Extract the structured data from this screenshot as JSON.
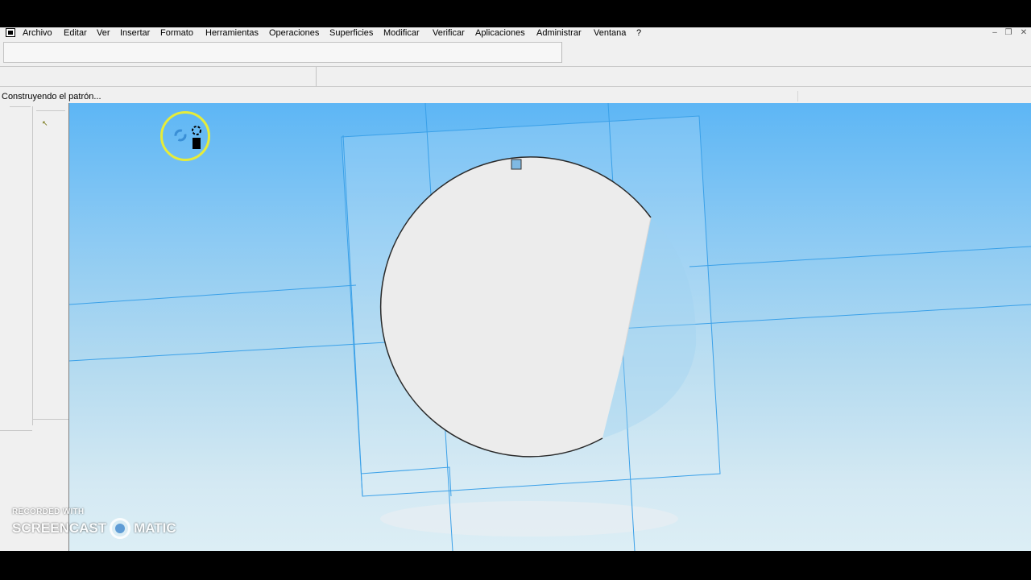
{
  "menubar": {
    "items": [
      "Archivo",
      "Editar",
      "Ver",
      "Insertar",
      "Formato",
      "Herramientas",
      "Operaciones",
      "Superficies",
      "Modificar",
      "Verificar",
      "Aplicaciones",
      "Administrar",
      "Ventana",
      "?"
    ]
  },
  "window_controls": {
    "minimize": "‒",
    "restore": "❐",
    "close": "✕"
  },
  "statusbar": {
    "text": "Construyendo el patrón..."
  },
  "viewport": {
    "background_top": "#5db6f5",
    "background_bottom": "#dceef5",
    "datum_color": "#3aa0e8",
    "edge_color": "#2a2a2a"
  },
  "watermark": {
    "line1": "RECORDED WITH",
    "line2_left": "SCREENCAST",
    "line2_right": "MATIC"
  },
  "icons": {
    "app": "app-icon",
    "busy_cursor": "busy-cursor-icon",
    "pointer": "pointer-icon"
  }
}
